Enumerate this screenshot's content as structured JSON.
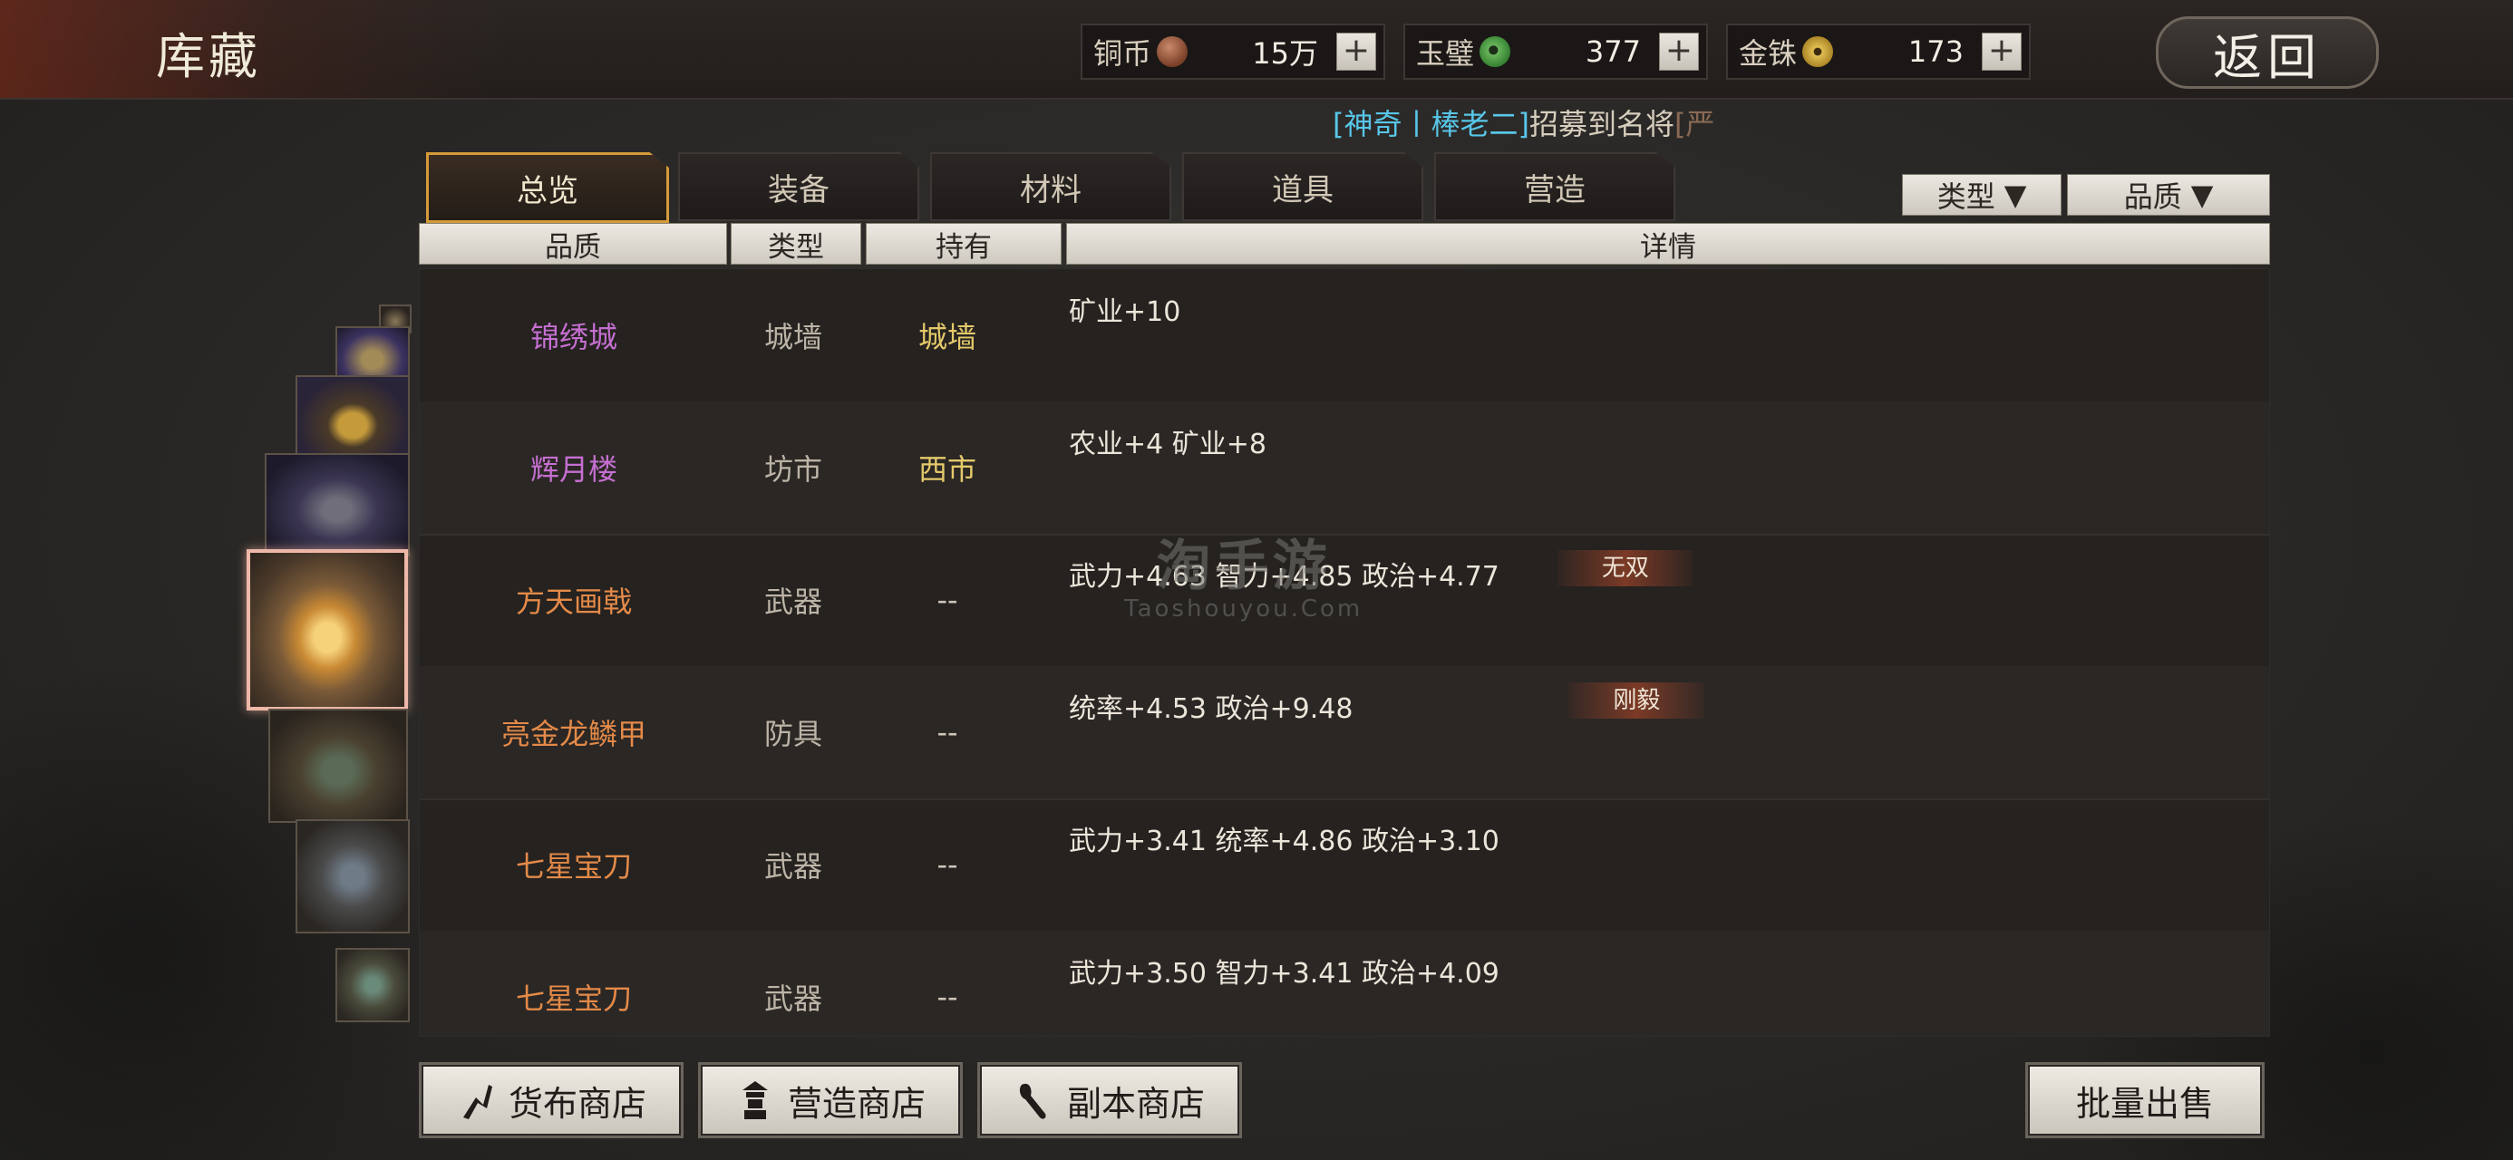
{
  "header": {
    "title": "库藏",
    "back_label": "返回"
  },
  "resources": [
    {
      "label": "铜币",
      "coin": "copper-coin-icon",
      "value": "15万"
    },
    {
      "label": "玉璧",
      "coin": "jade-disc-icon",
      "value": "377"
    },
    {
      "label": "金铢",
      "coin": "gold-coin-icon",
      "value": "173"
    }
  ],
  "resource_plus_label": "+",
  "marquee": {
    "prefix": "[",
    "name": "神奇丨棒老二",
    "suffix": "]",
    "text": "招募到名将",
    "tail": "[严"
  },
  "tabs": [
    "总览",
    "装备",
    "材料",
    "道具",
    "营造"
  ],
  "active_tab": "总览",
  "filters": {
    "type_label": "类型",
    "quality_label": "品质",
    "arrow": "▼"
  },
  "columns": {
    "quality": "品质",
    "type": "类型",
    "held": "持有",
    "detail": "详情"
  },
  "rows": [
    {
      "name": "锦绣城",
      "type": "城墙",
      "held": "城墙",
      "detail": "矿业+10",
      "badge": "",
      "name_color": "#c56fd1",
      "held_color": "#e4c96a"
    },
    {
      "name": "辉月楼",
      "type": "坊市",
      "held": "西市",
      "detail": "农业+4  矿业+8",
      "badge": "",
      "name_color": "#c56fd1",
      "held_color": "#e4c96a"
    },
    {
      "name": "方天画戟",
      "type": "武器",
      "held": "--",
      "detail": "武力+4.63  智力+4.85  政治+4.77",
      "badge": "无双",
      "name_color": "#e48a48",
      "held_color": "#cfc6b8"
    },
    {
      "name": "亮金龙鳞甲",
      "type": "防具",
      "held": "--",
      "detail": "统率+4.53  政治+9.48",
      "badge": "刚毅",
      "name_color": "#e48a48",
      "held_color": "#cfc6b8"
    },
    {
      "name": "七星宝刀",
      "type": "武器",
      "held": "--",
      "detail": "武力+3.41  统率+4.86  政治+3.10",
      "badge": "",
      "name_color": "#e48a48",
      "held_color": "#cfc6b8"
    },
    {
      "name": "七星宝刀",
      "type": "武器",
      "held": "--",
      "detail": "武力+3.50  智力+3.41  政治+4.09",
      "badge": "",
      "name_color": "#e48a48",
      "held_color": "#cfc6b8"
    }
  ],
  "watermark": {
    "line1": "淘手游",
    "line2": "Taoshouyou.Com"
  },
  "bottom_buttons": {
    "currency_shop": "货布商店",
    "build_shop": "营造商店",
    "dungeon_shop": "副本商店",
    "bulk_sell": "批量出售"
  }
}
